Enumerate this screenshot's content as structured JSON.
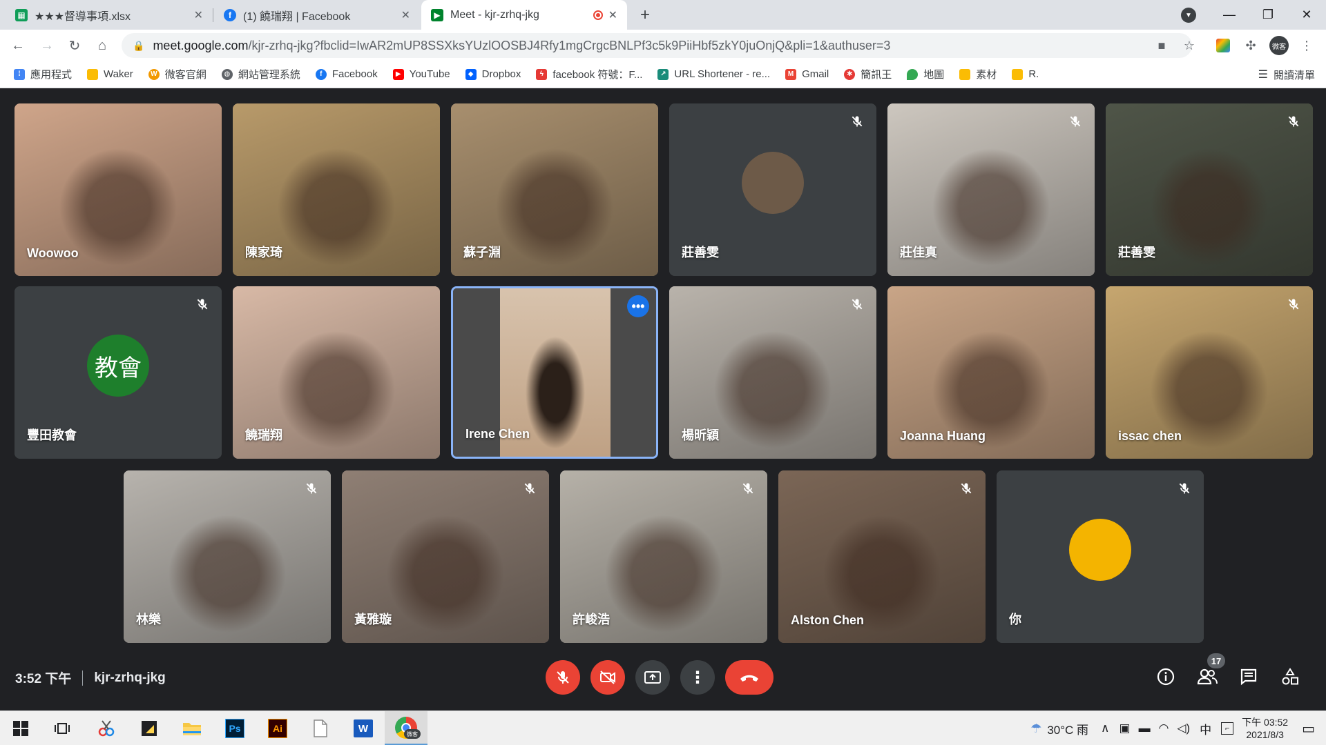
{
  "browser": {
    "tabs": [
      {
        "title": "★★★督導事項.xlsx",
        "favicon": "sheets-icon",
        "color": "#0f9d58",
        "active": false
      },
      {
        "title": "(1) 饒瑞翔 | Facebook",
        "favicon": "facebook-icon",
        "color": "#1877f2",
        "active": false
      },
      {
        "title": "Meet - kjr-zrhq-jkg",
        "favicon": "meet-icon",
        "color": "#00832d",
        "active": true
      }
    ],
    "new_tab_label": "+",
    "url_host": "meet.google.com",
    "url_rest": "/kjr-zrhq-jkg?fbclid=IwAR2mUP8SSXksYUzlOOSBJ4Rfy1mgCrgcBNLPf3c5k9PiiHbf5zkY0juOnjQ&pli=1&authuser=3",
    "profile_label": "微客",
    "bookmarks": [
      {
        "label": "應用程式",
        "color": "#4285f4"
      },
      {
        "label": "Waker",
        "color": "#fbbc04"
      },
      {
        "label": "微客官網",
        "color": "#f29900"
      },
      {
        "label": "網站管理系統",
        "color": "#5f6368"
      },
      {
        "label": "Facebook",
        "color": "#1877f2"
      },
      {
        "label": "YouTube",
        "color": "#ff0000"
      },
      {
        "label": "Dropbox",
        "color": "#0061fe"
      },
      {
        "label": "facebook 符號：F...",
        "color": "#e53935"
      },
      {
        "label": "URL Shortener - re...",
        "color": "#1a8c7a"
      },
      {
        "label": "Gmail",
        "color": "#ea4335"
      },
      {
        "label": "簡訊王",
        "color": "#e53935"
      },
      {
        "label": "地圖",
        "color": "#34a853"
      },
      {
        "label": "素材",
        "color": "#fbbc04"
      },
      {
        "label": "R.",
        "color": "#fbbc04"
      }
    ],
    "reading_list": "閱讀清單"
  },
  "meet": {
    "participants": [
      {
        "name": "Woowoo",
        "muted": false,
        "bg": "#cfa58a"
      },
      {
        "name": "陳家琦",
        "muted": false,
        "bg": "#b89a6a"
      },
      {
        "name": "蘇子淵",
        "muted": false,
        "bg": "#a88f6e"
      },
      {
        "name": "莊善雯",
        "muted": true,
        "bg": "#3c4043",
        "avatar": true,
        "avatar_color": "#6d5a48"
      },
      {
        "name": "莊佳真",
        "muted": true,
        "bg": "#cdc7bf"
      },
      {
        "name": "莊善雯",
        "muted": true,
        "bg": "#4f5548"
      },
      {
        "name": "豐田教會",
        "muted": true,
        "bg": "#3c4043",
        "avatar": true,
        "avatar_color": "#1e7f2c",
        "avatar_text": "教會"
      },
      {
        "name": "饒瑞翔",
        "muted": false,
        "bg": "#d8b9a6"
      },
      {
        "name": "Irene Chen",
        "muted": false,
        "bg": "#4a4a4a",
        "pinned": true
      },
      {
        "name": "楊昕穎",
        "muted": true,
        "bg": "#b9b3ab"
      },
      {
        "name": "Joanna Huang",
        "muted": false,
        "bg": "#c9a587"
      },
      {
        "name": "issac chen",
        "muted": true,
        "bg": "#c6a66f"
      },
      {
        "name": "林樂",
        "muted": true,
        "bg": "#b7b3ad"
      },
      {
        "name": "黃雅璇",
        "muted": true,
        "bg": "#8f7f74"
      },
      {
        "name": "許峻浩",
        "muted": true,
        "bg": "#b6b1a8"
      },
      {
        "name": "Alston Chen",
        "muted": true,
        "bg": "#7b6656"
      },
      {
        "name": "你",
        "muted": true,
        "bg": "#3c4043",
        "avatar": true,
        "avatar_color": "#f4b400"
      }
    ],
    "time": "3:52 下午",
    "meeting_code": "kjr-zrhq-jkg",
    "people_count": "17"
  },
  "taskbar": {
    "weather": "30°C 雨",
    "ime": "中",
    "clock_time": "下午 03:52",
    "clock_date": "2021/8/3",
    "ps_label": "Ps",
    "ai_label": "Ai",
    "word_label": "W",
    "chrome_label": "微客"
  }
}
